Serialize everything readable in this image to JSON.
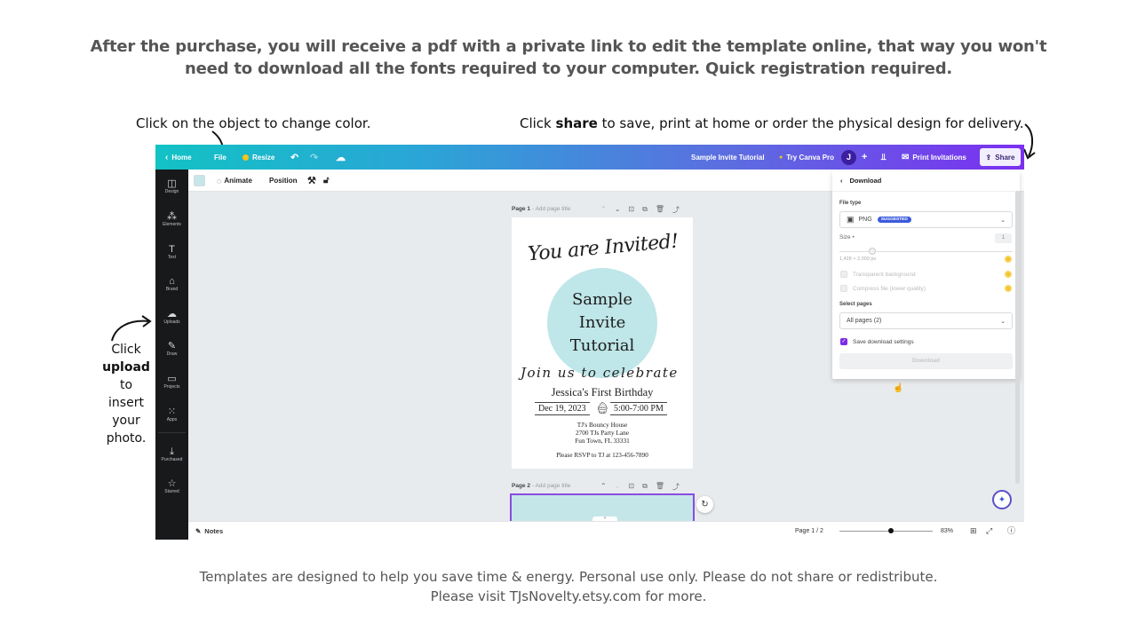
{
  "headline": {
    "line1": "After the purchase, you will receive a pdf with a private link to edit the template online, that way you won't",
    "line2": "need to download all the fonts required to your computer. Quick registration required."
  },
  "captions": {
    "color": "Click on the object to change color.",
    "share_pre": "Click ",
    "share_bold": "share",
    "share_post": " to save, print at home or order the physical design for delivery.",
    "upload_pre": "Click",
    "upload_bold": "upload",
    "upload_l3": "to",
    "upload_l4": "insert",
    "upload_l5": "your",
    "upload_l6": "photo."
  },
  "footer": {
    "line1": "Templates are designed to help you save time & energy. Personal use only. Please do not share or redistribute.",
    "line2": "Please visit TJsNovelty.etsy.com for more."
  },
  "topbar": {
    "home": "Home",
    "file": "File",
    "resize": "Resize",
    "doc_title": "Sample  Invite Tutorial",
    "try_pro": "Try Canva Pro",
    "avatar_initial": "J",
    "print": "Print Invitations",
    "share": "Share"
  },
  "sidebar": {
    "items": [
      {
        "label": "Design",
        "icon": "layout-icon"
      },
      {
        "label": "Elements",
        "icon": "shapes-icon"
      },
      {
        "label": "Text",
        "icon": "text-icon"
      },
      {
        "label": "Brand",
        "icon": "brand-icon"
      },
      {
        "label": "Uploads",
        "icon": "cloud-upload-icon"
      },
      {
        "label": "Draw",
        "icon": "pen-icon"
      },
      {
        "label": "Projects",
        "icon": "folder-icon"
      },
      {
        "label": "Apps",
        "icon": "grid-icon"
      },
      {
        "label": "Purchased",
        "icon": "download-icon"
      },
      {
        "label": "Starred",
        "icon": "star-icon"
      }
    ]
  },
  "toolbar": {
    "animate": "Animate",
    "position": "Position",
    "swatch_color": "#c7e6e9"
  },
  "pages": [
    {
      "label": "Page 1",
      "subtitle": "- Add page title"
    },
    {
      "label": "Page 2",
      "subtitle": "- Add page title"
    }
  ],
  "invite": {
    "title": "You are Invited!",
    "circle_l1": "Sample",
    "circle_l2": "Invite",
    "circle_l3": "Tutorial",
    "join": "Join us to celebrate",
    "name": "Jessica's First Birthday",
    "date": "Dec 19, 2023",
    "time": "5:00-7:00 PM",
    "venue": "TJ's Bouncy House",
    "street": "2700 TJs Party Lane",
    "city": "Fun Town, FL 33331",
    "rsvp": "Please RSVP to TJ at 123-456-7890",
    "circle_color": "#bfe6e8"
  },
  "download": {
    "title": "Download",
    "file_type_label": "File type",
    "file_type": "PNG",
    "badge": "SUGGESTED",
    "size_label": "Size •",
    "size_value": "1",
    "size_fraction": 0.19,
    "dimensions": "1,428 × 2,000 px",
    "transparent": "Transparent background",
    "compress": "Compress file (lower quality)",
    "select_pages_label": "Select pages",
    "pages_value": "All pages (2)",
    "save_settings": "Save download settings",
    "save_settings_checked": true,
    "button": "Download"
  },
  "bottombar": {
    "notes": "Notes",
    "page_indicator": "Page 1 / 2",
    "zoom": "83%",
    "zoom_fraction": 0.55
  },
  "colors": {
    "accent_purple": "#7d2ae8",
    "gradient_start": "#12c2c5",
    "gradient_end": "#7b2ff0",
    "pro_gold": "#f5c12e"
  }
}
